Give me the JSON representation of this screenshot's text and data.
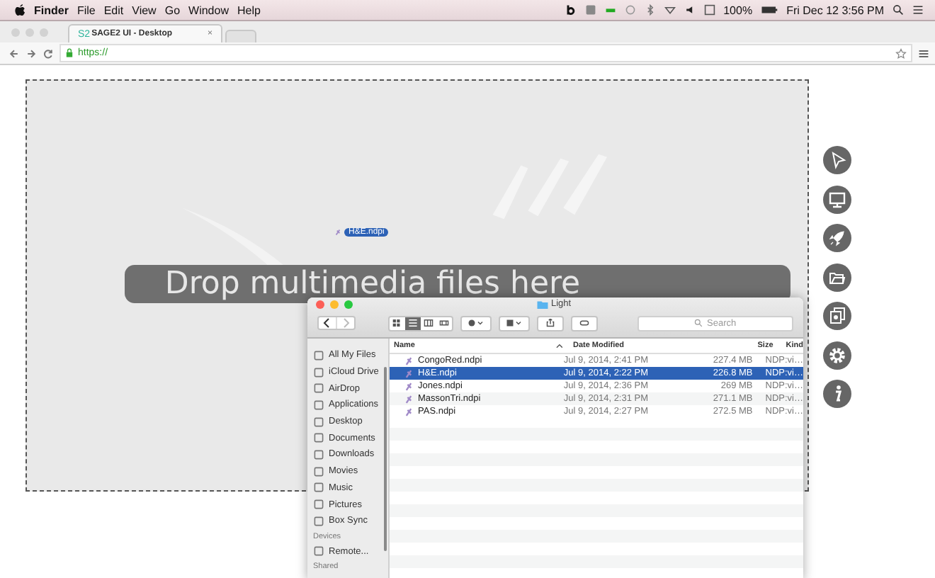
{
  "menu_bar": {
    "app_name": "Finder",
    "menus": [
      "File",
      "Edit",
      "View",
      "Go",
      "Window",
      "Help"
    ],
    "battery": "100%",
    "clock": "Fri Dec 12  3:56 PM"
  },
  "browser": {
    "tab": {
      "logo": "S2",
      "title": "SAGE2 UI - Desktop",
      "close": "×"
    },
    "url": "https://"
  },
  "drag_label": "H&E.ndpi",
  "drop_banner": "Drop multimedia files here",
  "finder": {
    "title": "Light",
    "search_placeholder": "Search",
    "view_modes": [
      {
        "selected": false
      },
      {
        "selected": true
      },
      {
        "selected": false
      },
      {
        "selected": false
      }
    ],
    "sidebar": [
      {
        "kind": "item",
        "label": "All My Files"
      },
      {
        "kind": "item",
        "label": "iCloud Drive"
      },
      {
        "kind": "item",
        "label": "AirDrop"
      },
      {
        "kind": "item",
        "label": "Applications"
      },
      {
        "kind": "item",
        "label": "Desktop"
      },
      {
        "kind": "item",
        "label": "Documents"
      },
      {
        "kind": "item",
        "label": "Downloads"
      },
      {
        "kind": "item",
        "label": "Movies"
      },
      {
        "kind": "item",
        "label": "Music"
      },
      {
        "kind": "item",
        "label": "Pictures"
      },
      {
        "kind": "item",
        "label": "Box Sync"
      },
      {
        "kind": "header",
        "label": "Devices"
      },
      {
        "kind": "item",
        "label": "Remote..."
      },
      {
        "kind": "header",
        "label": "Shared"
      }
    ],
    "columns": [
      "Name",
      "Date Modified",
      "Size",
      "Kind"
    ],
    "rows": [
      {
        "name": "CongoRed.ndpi",
        "date": "Jul 9, 2014, 2:41 PM",
        "size": "227.4 MB",
        "kind": "NDP:vi…",
        "selected": false
      },
      {
        "name": "H&E.ndpi",
        "date": "Jul 9, 2014, 2:22 PM",
        "size": "226.8 MB",
        "kind": "NDP:vi…",
        "selected": true
      },
      {
        "name": "Jones.ndpi",
        "date": "Jul 9, 2014, 2:36 PM",
        "size": "269 MB",
        "kind": "NDP:vi…",
        "selected": false
      },
      {
        "name": "MassonTri.ndpi",
        "date": "Jul 9, 2014, 2:31 PM",
        "size": "271.1 MB",
        "kind": "NDP:vi…",
        "selected": false
      },
      {
        "name": "PAS.ndpi",
        "date": "Jul 9, 2014, 2:27 PM",
        "size": "272.5 MB",
        "kind": "NDP:vi…",
        "selected": false
      }
    ]
  }
}
